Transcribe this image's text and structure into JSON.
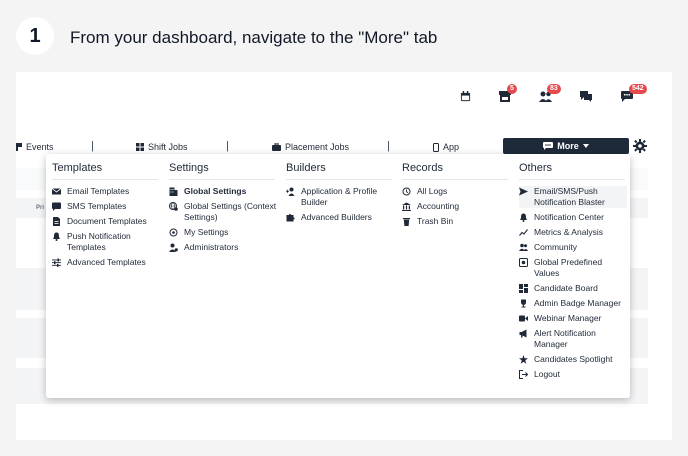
{
  "step": {
    "number": "1",
    "title": "From your dashboard, navigate to the \"More\" tab"
  },
  "top_icons": [
    {
      "icon": "calendar-icon"
    },
    {
      "icon": "store-icon",
      "badge": "5"
    },
    {
      "icon": "people-icon",
      "badge": "83"
    },
    {
      "icon": "chat-bubbles-icon"
    },
    {
      "icon": "message-icon",
      "badge": "542"
    }
  ],
  "nav": {
    "events": "Events",
    "shift_jobs": "Shift Jobs",
    "placement_jobs": "Placement Jobs",
    "app": "App",
    "more": "More",
    "sep": "|"
  },
  "background": {
    "row_label": "Pri"
  },
  "menu": {
    "templates": {
      "title": "Templates",
      "items": [
        "Email Templates",
        "SMS Templates",
        "Document Templates",
        "Push Notification Templates",
        "Advanced Templates"
      ]
    },
    "settings": {
      "title": "Settings",
      "items": [
        "Global Settings",
        "Global Settings (Context Settings)",
        "My Settings",
        "Administrators"
      ]
    },
    "builders": {
      "title": "Builders",
      "items": [
        "Application & Profile Builder",
        "Advanced Builders"
      ]
    },
    "records": {
      "title": "Records",
      "items": [
        "All Logs",
        "Accounting",
        "Trash Bin"
      ]
    },
    "others": {
      "title": "Others",
      "items": [
        "Email/SMS/Push Notification Blaster",
        "Notification Center",
        "Metrics & Analysis",
        "Community",
        "Global Predefined Values",
        "Candidate Board",
        "Admin Badge Manager",
        "Webinar Manager",
        "Alert Notification Manager",
        "Candidates Spotlight",
        "Logout"
      ]
    }
  },
  "colors": {
    "more_button_bg": "#1e2a3a",
    "badge": "#e5484d"
  }
}
